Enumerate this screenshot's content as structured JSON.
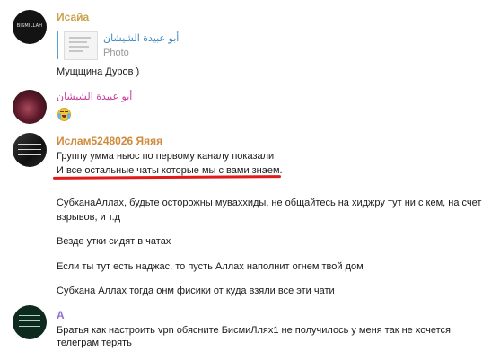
{
  "messages": [
    {
      "sender": "Исайа",
      "avatar_text": "BISMILLAH",
      "reply": {
        "name": "أبو عبيدة الشيشان",
        "subtitle": "Photo"
      },
      "lines": [
        "Мущщина Дуров )"
      ]
    },
    {
      "sender": "أبو عبيدة الشيشان",
      "emoji": "crying-face"
    },
    {
      "sender": "Ислам5248026 Яяяя",
      "lines": [
        "Группу умма ньюс по первому каналу показали",
        "И все остальные чаты которые мы с вами знаем.",
        "СубханаАллах, будьте осторожны муваххиды, не общайтесь на хиджру тут ни с кем, на счет",
        "взрывов, и т.д",
        "Везде утки сидят в чатах",
        "Если ты тут есть наджас, то пусть Аллах наполнит огнем твой дом",
        "Субхана Аллах тогда онм фисики от куда взяли все эти чати"
      ]
    },
    {
      "sender": "А",
      "lines": [
        "Братья как настроить vpn  обясните   БисмиЛлях1 не получилось у меня так не хочется",
        "телеграм терять"
      ]
    }
  ],
  "colors": {
    "sender1": "#c9a24a",
    "sender2": "#c63a9a",
    "sender3": "#d08a3c",
    "sender4": "#8f6fc9",
    "reply_bar": "#5c9fd6",
    "underline": "#e11a1a"
  }
}
